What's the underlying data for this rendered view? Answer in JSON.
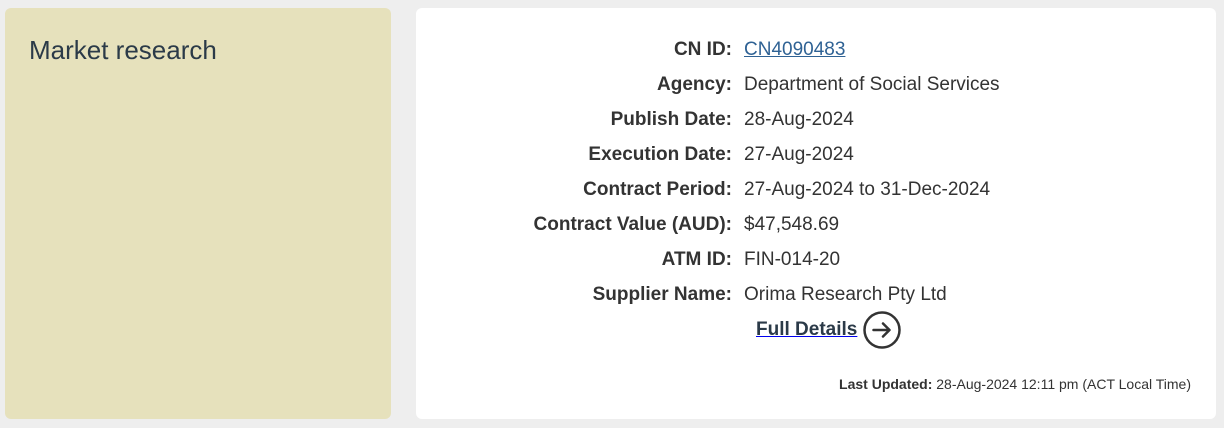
{
  "left": {
    "title": "Market research"
  },
  "details": {
    "rows": [
      {
        "label": "CN ID:",
        "value": "CN4090483"
      },
      {
        "label": "Agency:",
        "value": "Department of Social Services"
      },
      {
        "label": "Publish Date:",
        "value": "28-Aug-2024"
      },
      {
        "label": "Execution Date:",
        "value": "27-Aug-2024"
      },
      {
        "label": "Contract Period:",
        "value": "27-Aug-2024 to 31-Dec-2024"
      },
      {
        "label": "Contract Value (AUD):",
        "value": "$47,548.69"
      },
      {
        "label": "ATM ID:",
        "value": "FIN-014-20"
      },
      {
        "label": "Supplier Name:",
        "value": "Orima Research Pty Ltd"
      }
    ],
    "full_details_label": "Full Details",
    "full_details_icon": "arrow-right-circle-icon",
    "last_updated_label": "Last Updated:",
    "last_updated_value": "28-Aug-2024 12:11 pm (ACT Local Time)"
  },
  "colors": {
    "left_panel_bg": "#e6e1bc",
    "link": "#2f6294",
    "heading": "#2b3a48"
  }
}
